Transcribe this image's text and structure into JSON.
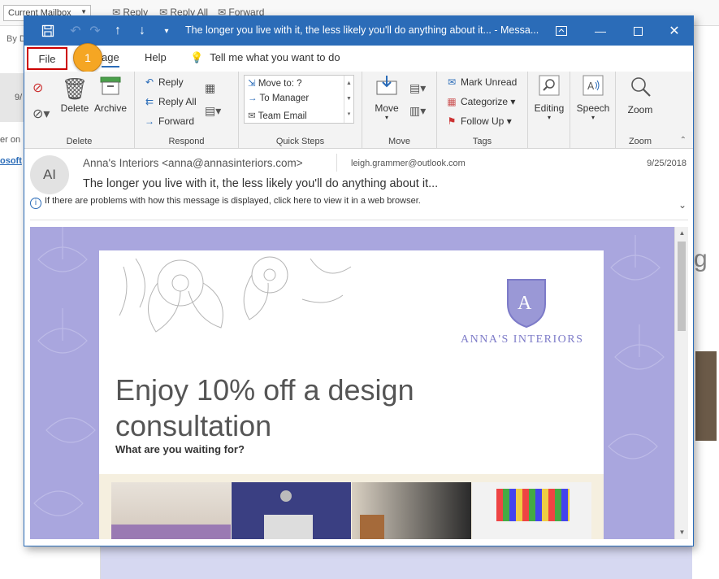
{
  "background": {
    "mailbox_scope": "Current Mailbox",
    "top_actions": [
      "Reply",
      "Reply All",
      "Forward"
    ],
    "left_fragments": [
      "By D",
      "9/",
      "er on",
      "osoft"
    ],
    "right_fragment": "g"
  },
  "window": {
    "title": "The longer you live with it, the less likely you'll do anything about it...  -  Messa...",
    "accent_color": "#2b6cb8"
  },
  "menu": {
    "file": "File",
    "message": "age",
    "help": "Help",
    "tell_me": "Tell me what you want to do",
    "step_badge": "1"
  },
  "ribbon": {
    "delete_group": {
      "label": "Delete",
      "delete": "Delete",
      "archive": "Archive"
    },
    "respond_group": {
      "label": "Respond",
      "reply": "Reply",
      "reply_all": "Reply All",
      "forward": "Forward"
    },
    "quick_steps_group": {
      "label": "Quick Steps",
      "items": [
        "Move to: ?",
        "To Manager",
        "Team Email"
      ]
    },
    "move_group": {
      "label": "Move",
      "move": "Move"
    },
    "tags_group": {
      "label": "Tags",
      "mark_unread": "Mark Unread",
      "categorize": "Categorize",
      "follow_up": "Follow Up"
    },
    "editing": "Editing",
    "speech": "Speech",
    "zoom_group": {
      "label": "Zoom",
      "zoom": "Zoom"
    }
  },
  "message": {
    "avatar_initials": "AI",
    "from": "Anna's Interiors <anna@annasinteriors.com>",
    "to": "leigh.grammer@outlook.com",
    "date": "9/25/2018",
    "subject": "The longer you live with it, the less likely you'll do anything about it...",
    "info": "If there are problems with how this message is displayed, click here to view it in a web browser."
  },
  "email_body": {
    "logo_letter": "A",
    "logo_text": "ANNA'S INTERIORS",
    "headline": "Enjoy 10% off a design consultation",
    "subheadline": "What are you waiting for?",
    "background_color": "#a9a6de",
    "logo_color": "#7d7bc8"
  }
}
